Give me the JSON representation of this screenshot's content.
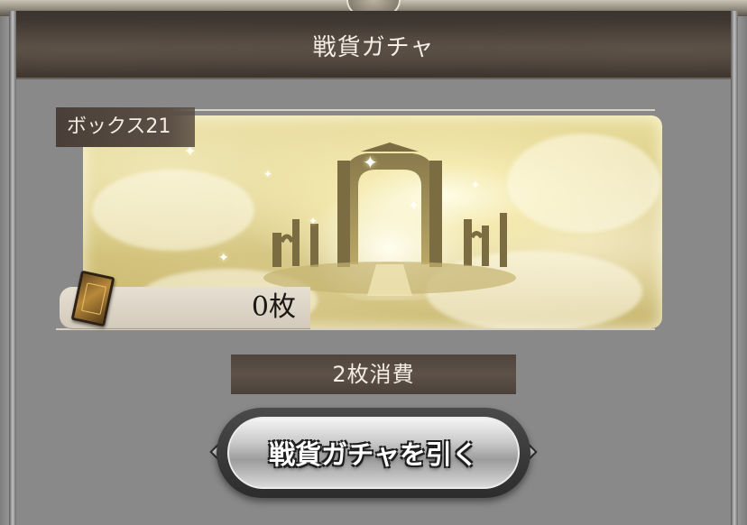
{
  "header": {
    "title": "戦貨ガチャ"
  },
  "box": {
    "label": "ボックス21",
    "ticket_count": "0枚",
    "ticket_icon": "ticket-card-icon"
  },
  "cost": {
    "label": "2枚消費"
  },
  "actions": {
    "draw_label": "戦貨ガチャを引く"
  },
  "colors": {
    "header_bg": "#3b332d",
    "panel_bg": "#8a8a8a",
    "label_bg": "#4f443c",
    "banner_gold": "#e9dd9c"
  }
}
